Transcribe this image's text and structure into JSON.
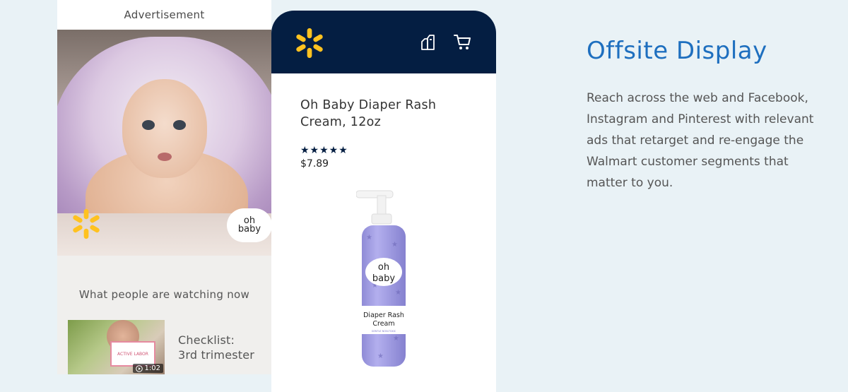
{
  "left_phone": {
    "header": "Advertisement",
    "brand_badge": [
      "oh",
      "baby"
    ],
    "watching_heading": "What people are watching now",
    "video": {
      "title_line1": "Checklist:",
      "title_line2": "3rd trimester",
      "duration": "1:02",
      "card_text": "ACTIVE LABOR"
    }
  },
  "right_phone": {
    "header_icons": [
      "walmart-spark-icon",
      "compare-icon",
      "cart-icon"
    ],
    "product": {
      "title": "Oh Baby Diaper Rash Cream, 12oz",
      "rating_stars": "★★★★★",
      "price": "$7.89",
      "label_brand": [
        "oh",
        "baby"
      ],
      "label_name": [
        "Diaper Rash",
        "Cream"
      ],
      "label_sub": "GENTLE NON-TOXIC"
    }
  },
  "info": {
    "headline": "Offsite Display",
    "description": "Reach across the web and Facebook, Instagram and Pinterest with relevant ads that retarget and re-engage the Walmart customer segments that matter to you."
  },
  "colors": {
    "background": "#e9f2f6",
    "walmart_navy": "#041e42",
    "walmart_yellow": "#ffc220",
    "headline_blue": "#1e6fbf",
    "bottle_lavender": "#a7a3e6"
  }
}
